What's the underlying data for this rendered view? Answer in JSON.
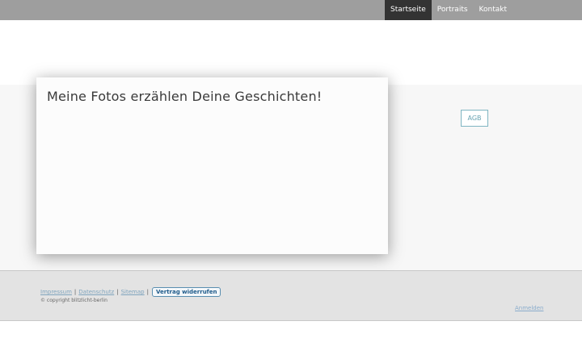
{
  "nav": {
    "items": [
      {
        "label": "Startseite",
        "active": true
      },
      {
        "label": "Portraits",
        "active": false
      },
      {
        "label": "Kontakt",
        "active": false
      }
    ]
  },
  "hero": {
    "title": "Meine Fotos erzählen Deine Geschichten!"
  },
  "sidebar": {
    "agb_label": "AGB"
  },
  "footer": {
    "links": [
      "Impressum",
      "Datenschutz",
      "Sitemap"
    ],
    "separator": "|",
    "revoke_button": "Vertrag widerrufen",
    "copyright": "© copyright blitzlicht-berlin",
    "login": "Anmelden"
  },
  "colors": {
    "topbar": "#9e9e9e",
    "nav_active": "#333333",
    "accent": "#6aa4b3",
    "footer_bg": "#e3e3e3"
  }
}
